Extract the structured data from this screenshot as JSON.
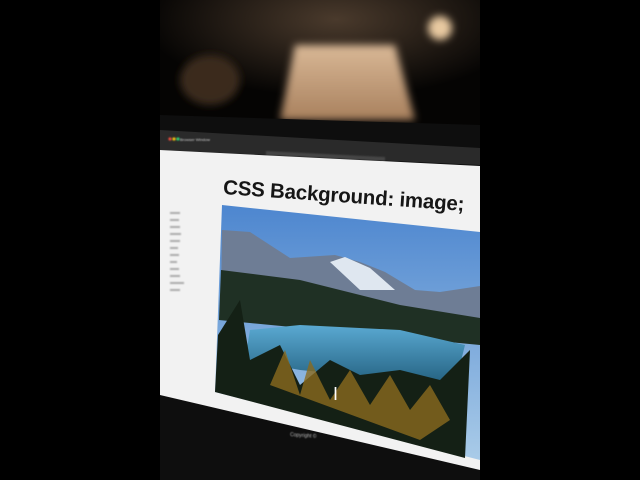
{
  "browser": {
    "tab_title": "Browser Window"
  },
  "page": {
    "heading": "CSS Background: image;",
    "footer": "Copyright ©"
  },
  "colors": {
    "page_bg": "#f2f2f2",
    "frame": "#1a1a1a",
    "sky": "#5e96d8",
    "lake": "#3d8fbf"
  }
}
